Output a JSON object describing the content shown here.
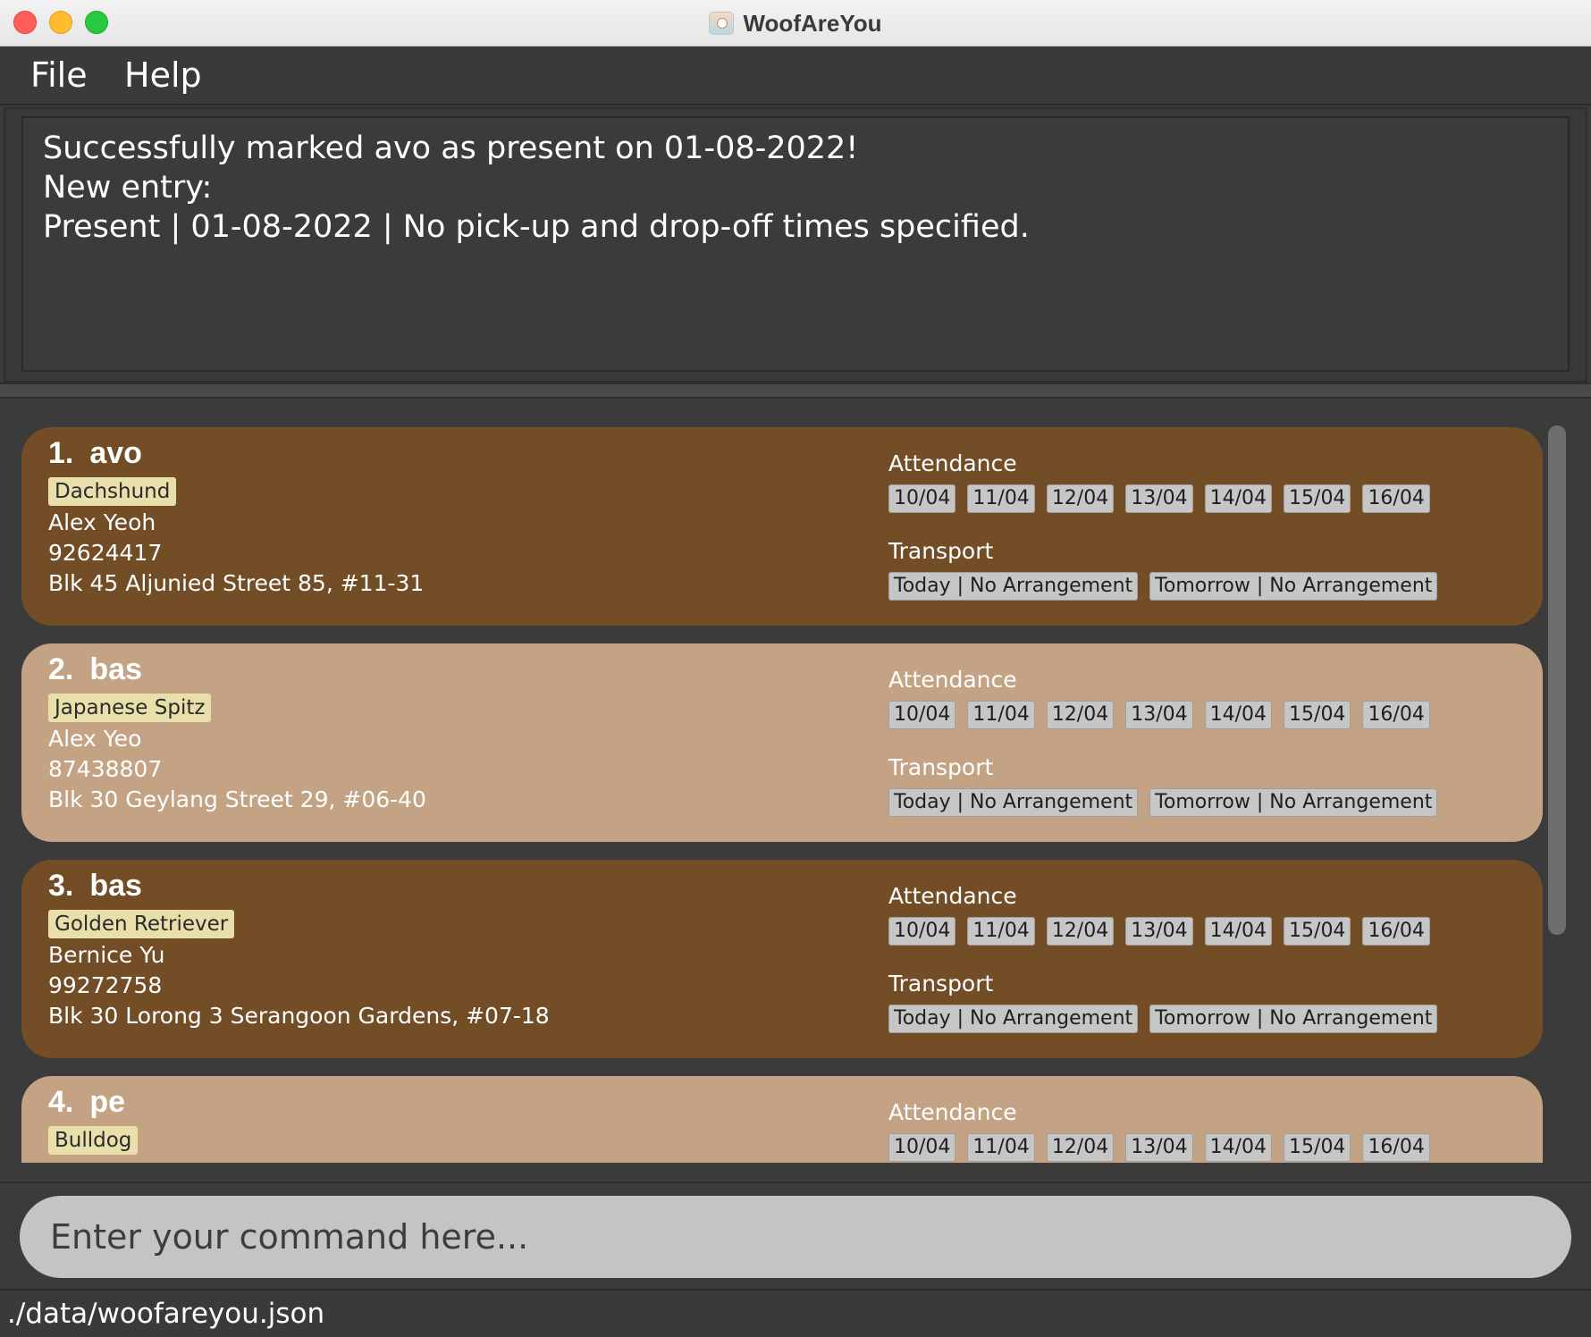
{
  "window": {
    "title": "WoofAreYou",
    "app_icon": "dog-app-icon"
  },
  "menu": {
    "file_label": "File",
    "help_label": "Help"
  },
  "result": {
    "lines": [
      "Successfully marked avo as present on 01-08-2022!",
      "New entry:",
      "Present | 01-08-2022 | No pick-up and drop-off times specified."
    ]
  },
  "list": {
    "attendance_label": "Attendance",
    "transport_label": "Transport",
    "dates": [
      "10/04",
      "11/04",
      "12/04",
      "13/04",
      "14/04",
      "15/04",
      "16/04"
    ],
    "pets": [
      {
        "index": "1.",
        "name": "avo",
        "breed": "Dachshund",
        "owner": "Alex Yeoh",
        "phone": "92624417",
        "address": "Blk 45 Aljunied Street 85, #11-31",
        "transport": [
          "Today | No Arrangement",
          "Tomorrow | No Arrangement"
        ]
      },
      {
        "index": "2.",
        "name": "bas",
        "breed": "Japanese Spitz",
        "owner": "Alex Yeo",
        "phone": "87438807",
        "address": "Blk 30 Geylang Street 29, #06-40",
        "transport": [
          "Today | No Arrangement",
          "Tomorrow | No Arrangement"
        ]
      },
      {
        "index": "3.",
        "name": "bas",
        "breed": "Golden Retriever",
        "owner": "Bernice Yu",
        "phone": "99272758",
        "address": "Blk 30 Lorong 3 Serangoon Gardens, #07-18",
        "transport": [
          "Today | No Arrangement",
          "Tomorrow | No Arrangement"
        ]
      },
      {
        "index": "4.",
        "name": "pe",
        "breed": "Bulldog"
      }
    ]
  },
  "command": {
    "placeholder": "Enter your command here..."
  },
  "status": {
    "file_path": "./data/woofareyou.json"
  },
  "colors": {
    "card_dark": "#734d26",
    "card_light": "#c4a384",
    "breed_tag": "#e8dfaa",
    "date_tag": "#c6c6c6",
    "background": "#3b3b3b"
  }
}
